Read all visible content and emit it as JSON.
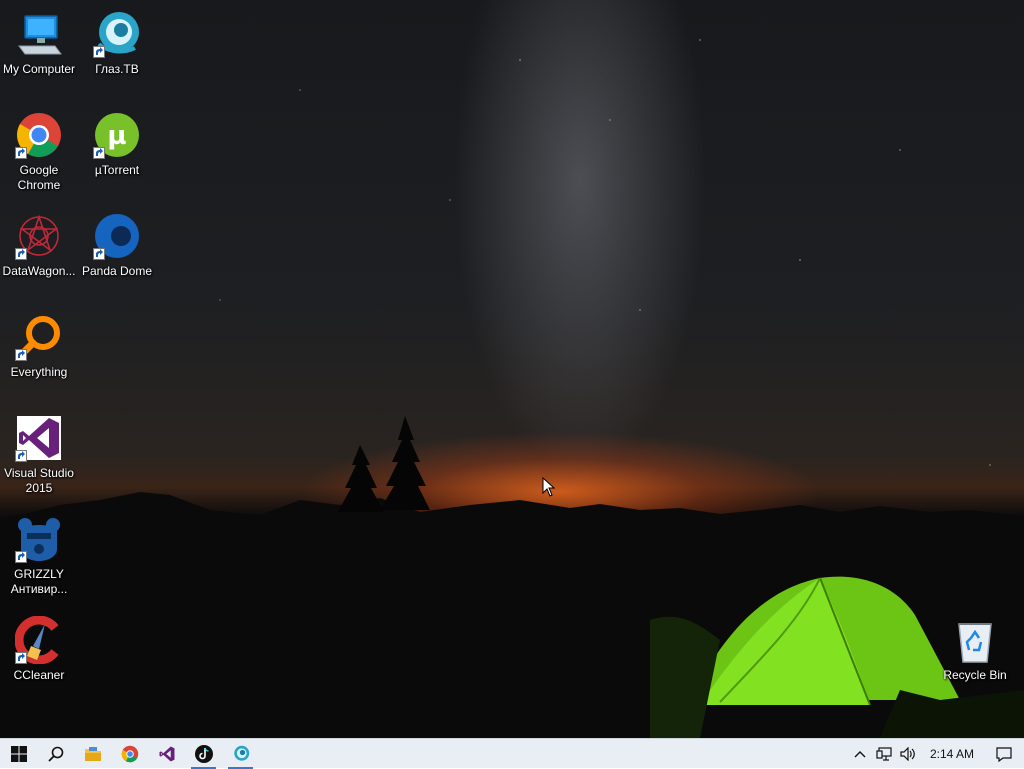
{
  "desktop": {
    "icons": [
      {
        "id": "my-computer",
        "label": "My Computer",
        "icon": "computer-icon"
      },
      {
        "id": "glaz-tv",
        "label": "Глаз.ТВ",
        "icon": "eye-tv-icon"
      },
      {
        "id": "google-chrome",
        "label": "Google Chrome",
        "icon": "chrome-icon"
      },
      {
        "id": "utorrent",
        "label": "µTorrent",
        "icon": "utorrent-icon"
      },
      {
        "id": "datawagon",
        "label": "DataWagon...",
        "icon": "datawagon-icon"
      },
      {
        "id": "panda-dome",
        "label": "Panda Dome",
        "icon": "panda-dome-icon"
      },
      {
        "id": "everything",
        "label": "Everything",
        "icon": "magnifier-icon"
      },
      {
        "id": "visual-studio",
        "label": "Visual Studio 2015",
        "icon": "visual-studio-icon"
      },
      {
        "id": "grizzly",
        "label": "GRIZZLY Антивир...",
        "icon": "bear-icon"
      },
      {
        "id": "ccleaner",
        "label": "CCleaner",
        "icon": "ccleaner-icon"
      },
      {
        "id": "recycle-bin",
        "label": "Recycle Bin",
        "icon": "recycle-bin-icon"
      }
    ]
  },
  "taskbar": {
    "start": "windows-logo-icon",
    "search": "search-icon",
    "pinned": [
      {
        "name": "file-explorer",
        "icon": "folder-icon"
      },
      {
        "name": "chrome",
        "icon": "chrome-icon"
      },
      {
        "name": "visual-studio",
        "icon": "visual-studio-icon"
      },
      {
        "name": "tiktok",
        "icon": "tiktok-icon"
      },
      {
        "name": "glaz-tv",
        "icon": "eye-tv-icon"
      }
    ],
    "tray": {
      "chevron": "chevron-up-icon",
      "network": "network-icon",
      "volume": "volume-icon",
      "time": "2:14 AM",
      "notifications": "notification-icon"
    }
  },
  "colors": {
    "taskbar_bg": "#e9eef4",
    "accent": "#3a78c9",
    "tent_green": "#7bdc1c",
    "horizon_orange": "#ff6e1e"
  }
}
